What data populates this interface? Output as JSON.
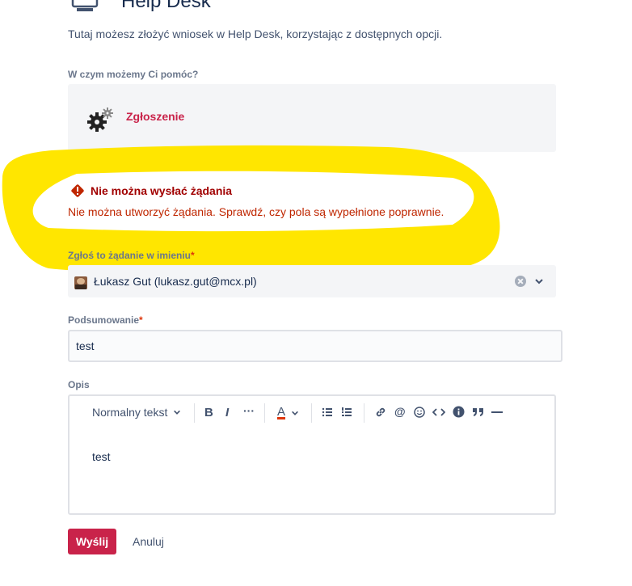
{
  "header": {
    "title": "Help Desk",
    "intro": "Tutaj możesz złożyć wniosek w Help Desk, korzystając z dostępnych opcji."
  },
  "request_type": {
    "section_label": "W czym możemy Ci pomóc?",
    "selected_label": "Zgłoszenie"
  },
  "error": {
    "title": "Nie można wysłać żądania",
    "message": "Nie można utworzyć żądania. Sprawdź, czy pola są wypełnione poprawnie."
  },
  "on_behalf": {
    "label": "Zgłoś to żądanie w imieniu",
    "required_marker": "*",
    "value": "Łukasz Gut (lukasz.gut@mcx.pl)"
  },
  "summary": {
    "label": "Podsumowanie",
    "required_marker": "*",
    "value": "test"
  },
  "description": {
    "label": "Opis",
    "toolbar": {
      "text_style": "Normalny tekst",
      "bold": "B",
      "italic": "I",
      "more": "···",
      "text_color": "A",
      "bullet_list": "☰",
      "numbered_list": "☷",
      "link": "🔗",
      "mention": "@",
      "emoji": "☺",
      "code": "<>",
      "info": "i",
      "quote": "”",
      "divider": "—"
    },
    "value": "test"
  },
  "actions": {
    "submit_label": "Wyślij",
    "cancel_label": "Anuluj"
  },
  "colors": {
    "accent": "#c9234a",
    "error": "#bf2600",
    "highlight": "#ffe600"
  }
}
